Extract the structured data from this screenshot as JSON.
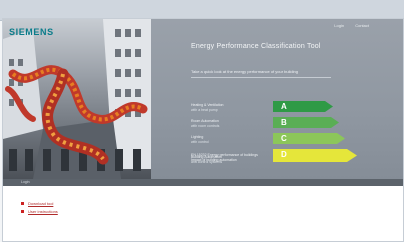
{
  "brand": {
    "logo_text": "SIEMENS",
    "accent": "#0a7c8a"
  },
  "utility_links": [
    "Login",
    "Contact"
  ],
  "hero": {
    "title": "Energy Performance Classification Tool",
    "subtitle": "Take a quick look at the energy performance of your building",
    "labels": [
      {
        "title": "Heating & Ventilation",
        "sub": "with a heat pump"
      },
      {
        "title": "Room Automation",
        "sub": "with room controls"
      },
      {
        "title": "Lighting",
        "sub": "with control"
      },
      {
        "title": "Building Automation",
        "sub": "and control systems"
      }
    ],
    "notes": [
      "EN 15232 Energy performance of buildings",
      "Impact of building automation"
    ],
    "bars": [
      {
        "letter": "A",
        "color": "#2f9a46"
      },
      {
        "letter": "B",
        "color": "#5aae55"
      },
      {
        "letter": "C",
        "color": "#8cc65a"
      },
      {
        "letter": "D",
        "color": "#e5e63a"
      }
    ]
  },
  "nav": {
    "crumb": "Login"
  },
  "links": [
    {
      "label": "Download tool"
    },
    {
      "label": "User instructions"
    }
  ]
}
